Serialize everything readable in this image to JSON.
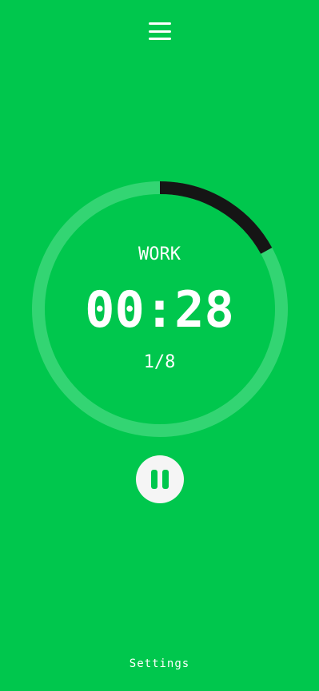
{
  "header": {
    "menu_icon": "hamburger-menu-icon"
  },
  "timer": {
    "phase": "WORK",
    "time": "00:28",
    "round": "1/8",
    "progress": 0.17
  },
  "controls": {
    "pause_icon": "pause-icon"
  },
  "footer": {
    "settings_label": "Settings"
  },
  "colors": {
    "background": "#00c74d",
    "ring_track": "#33d573",
    "ring_progress": "#151515",
    "text": "#ffffff",
    "button_bg": "#f5f5f5"
  }
}
